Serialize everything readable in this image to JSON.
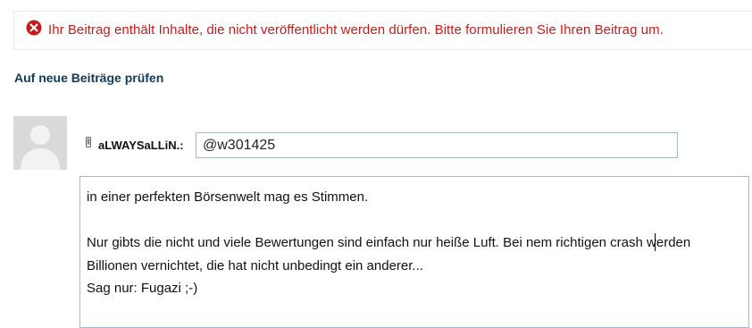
{
  "error": {
    "icon": "error-circle-icon",
    "color": "#cc1a1a",
    "message": "Ihr Beitrag enthält Inhalte, die nicht veröffentlicht werden dürfen. Bitte formulieren Sie Ihren Beitrag um."
  },
  "actions": {
    "check_new_posts": "Auf neue Beiträge prüfen"
  },
  "reply": {
    "avatar_icon": "default-user-avatar-icon",
    "device_icon": "mobile-phone-icon",
    "username": "aLWAYSaLLiN.:",
    "recipient_value": "@w301425",
    "message_lines": [
      "in einer perfekten Börsenwelt mag es Stimmen.",
      "",
      "Nur gibts die nicht und viele Bewertungen sind einfach nur heiße Luft. Bei nem richtigen crash werden",
      "Billionen vernichtet, die hat nicht unbedingt ein anderer...",
      "Sag nur: Fugazi ;-)"
    ]
  }
}
